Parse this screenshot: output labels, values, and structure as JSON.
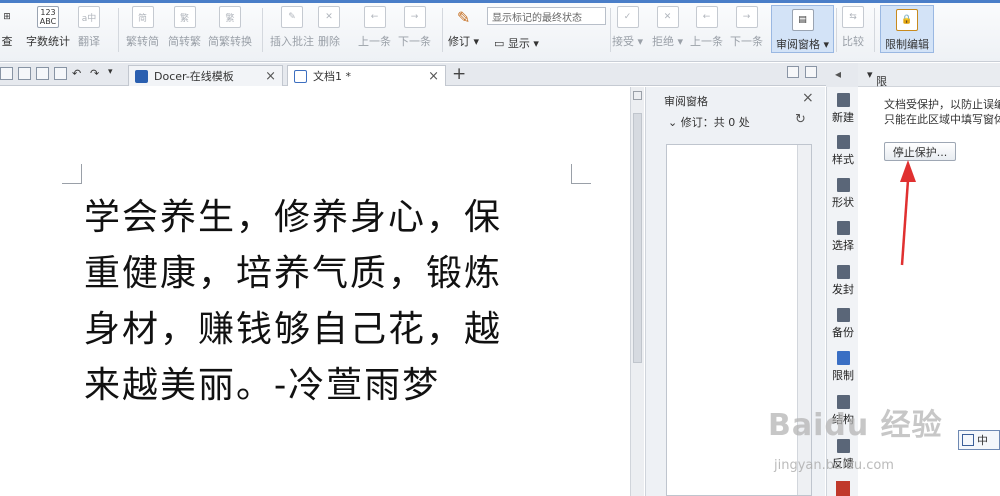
{
  "ribbon": {
    "word_count_label": "字数统计",
    "translate_label": "翻译",
    "view_label": "查",
    "trad_to_simp_label": "繁转简",
    "simp_to_trad_label": "简转繁",
    "simp_trad_convert_label": "简繁转换",
    "insert_comment_label": "插入批注",
    "delete_label": "删除",
    "prev_label": "上一条",
    "next_label": "下一条",
    "track_changes_label": "修订",
    "display_label": "显示",
    "display_select_value": "显示标记的最终状态",
    "accept_label": "接受",
    "reject_label": "拒绝",
    "prev2_label": "上一条",
    "next2_label": "下一条",
    "review_pane_label": "审阅窗格",
    "compare_label": "比较",
    "restrict_edit_label": "限制编辑",
    "abc_icon_text": "123\nABC"
  },
  "tabs": [
    {
      "label": "Docer-在线模板",
      "active": false
    },
    {
      "label": "文档1 *",
      "active": true
    }
  ],
  "document": {
    "lines": [
      "学会养生，修养身心，保",
      "重健康，培养气质，锻炼",
      "身材，赚钱够自己花，越",
      "来越美丽。-冷萱雨梦"
    ]
  },
  "review_pane": {
    "title": "审阅窗格",
    "revision_count": "修订：共 0 处"
  },
  "side_strip": [
    {
      "label": "新建",
      "icon": "new-doc-icon"
    },
    {
      "label": "样式",
      "icon": "style-icon"
    },
    {
      "label": "形状",
      "icon": "shape-icon"
    },
    {
      "label": "选择",
      "icon": "select-icon"
    },
    {
      "label": "发封",
      "icon": "send-icon"
    },
    {
      "label": "备份",
      "icon": "backup-icon"
    },
    {
      "label": "限制",
      "icon": "restrict-icon"
    },
    {
      "label": "结构",
      "icon": "structure-icon"
    },
    {
      "label": "反馈",
      "icon": "feedback-icon"
    }
  ],
  "restrict_panel": {
    "title": "限制编辑",
    "line1": "文档受保护，以防止误编",
    "line2": "只能在此区域中填写窗体",
    "stop_button": "停止保护..."
  },
  "ime": {
    "label": "中"
  },
  "watermark": {
    "main": "Baidu 经验",
    "sub": "jingyan.baidu.com"
  }
}
